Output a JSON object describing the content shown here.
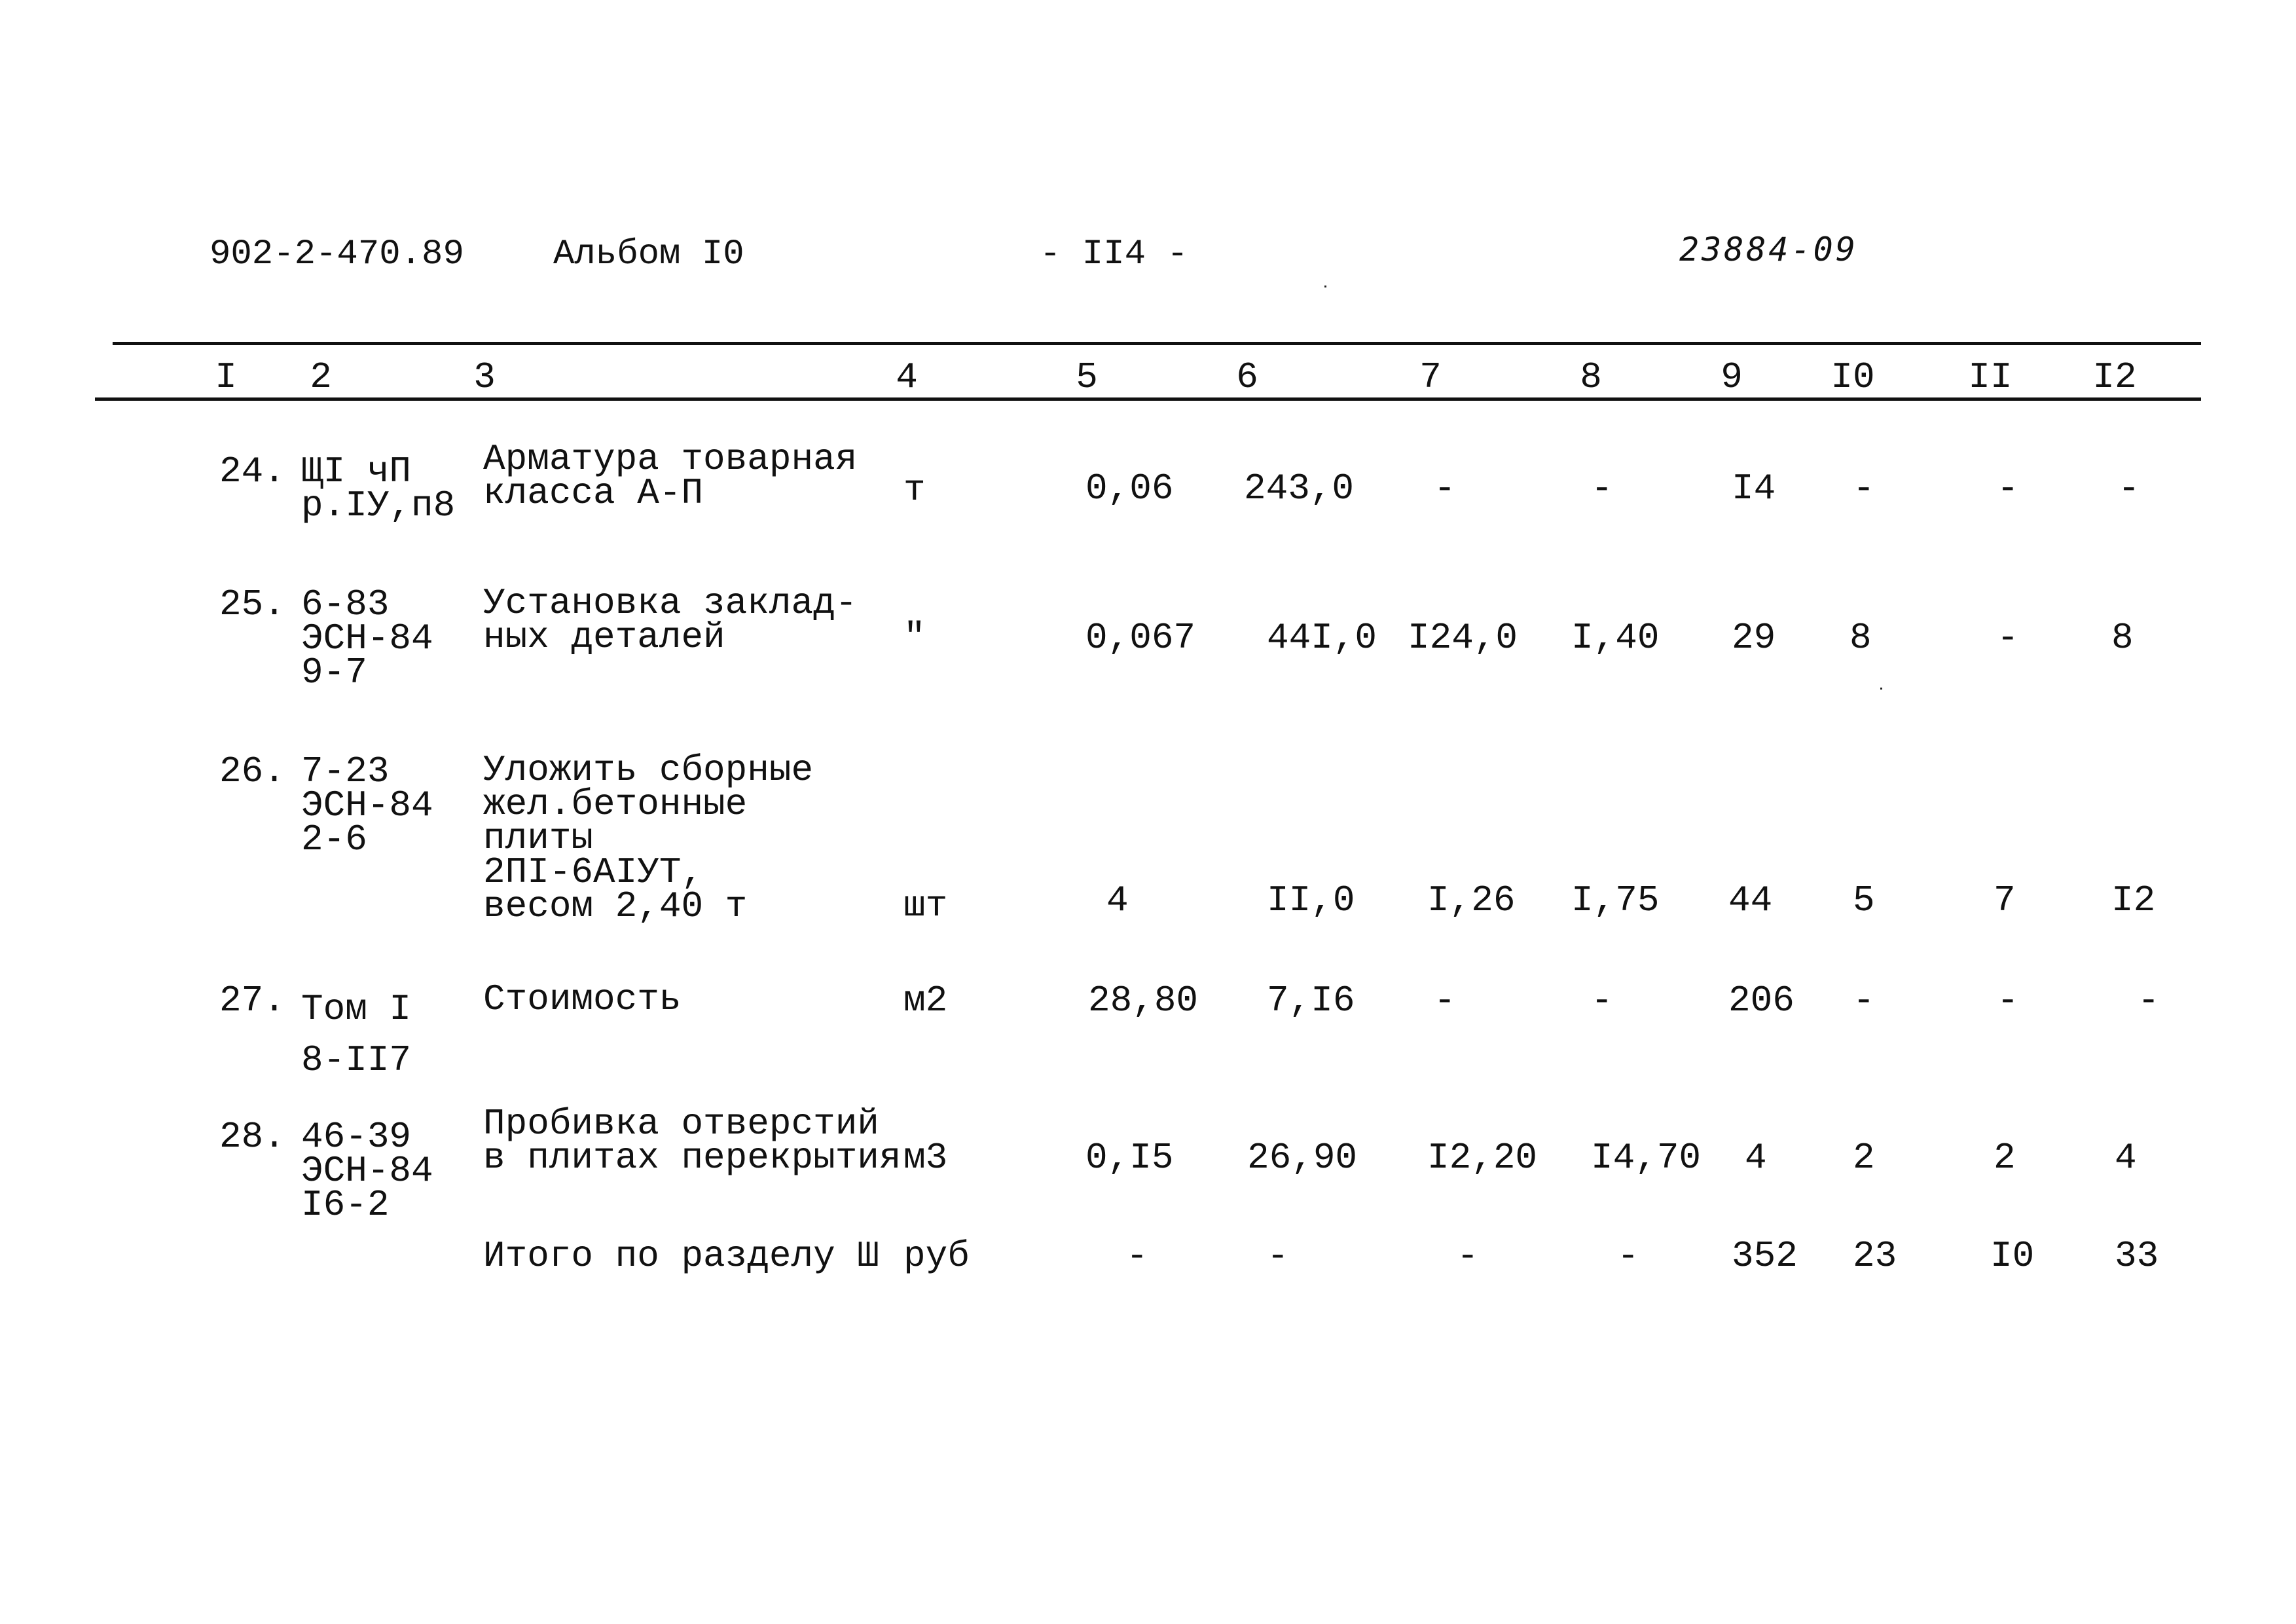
{
  "header": {
    "doc_code": "902-2-470.89",
    "album": "Альбом I0",
    "page": "- II4 -",
    "stamp": "23884-09"
  },
  "columns": [
    "I",
    "2",
    "3",
    "4",
    "5",
    "6",
    "7",
    "8",
    "9",
    "I0",
    "II",
    "I2"
  ],
  "rows": [
    {
      "num": "24.",
      "ref": [
        "ЩI чП",
        "р.IУ,п8"
      ],
      "name": [
        "Арматура товарная",
        "класса А-П"
      ],
      "unit": "т",
      "values": [
        "0,06",
        "243,0",
        "-",
        "-",
        "I4",
        "-",
        "-",
        "-"
      ]
    },
    {
      "num": "25.",
      "ref": [
        "6-83",
        "ЭСН-84",
        "9-7"
      ],
      "name": [
        "Установка заклад-",
        "ных деталей"
      ],
      "unit": "\"",
      "values": [
        "0,067",
        "44I,0",
        "I24,0",
        "I,40",
        "29",
        "8",
        "-",
        "8"
      ]
    },
    {
      "num": "26.",
      "ref": [
        "7-23",
        "ЭСН-84",
        "2-6"
      ],
      "name": [
        "Уложить сборные",
        "жел.бетонные",
        "плиты",
        "2ПI-6АIУТ,",
        "весом 2,40 т"
      ],
      "unit": "шт",
      "values": [
        "4",
        "II,0",
        "I,26",
        "I,75",
        "44",
        "5",
        "7",
        "I2"
      ]
    },
    {
      "num": "27.",
      "ref": [
        "Том I",
        "8-II7"
      ],
      "name": [
        "Стоимость"
      ],
      "unit": "м2",
      "values": [
        "28,80",
        "7,I6",
        "-",
        "-",
        "206",
        "-",
        "-",
        "-"
      ]
    },
    {
      "num": "28.",
      "ref": [
        "46-39",
        "ЭСН-84",
        "I6-2"
      ],
      "name": [
        "Пробивка отверстий",
        "в плитах перекрытия"
      ],
      "unit": "м3",
      "values": [
        "0,I5",
        "26,90",
        "I2,20",
        "I4,70",
        "4",
        "2",
        "2",
        "4"
      ]
    }
  ],
  "total": {
    "name": "Итого по разделу Ш",
    "unit": "руб",
    "values": [
      "-",
      "-",
      "-",
      "-",
      "352",
      "23",
      "I0",
      "33"
    ]
  }
}
